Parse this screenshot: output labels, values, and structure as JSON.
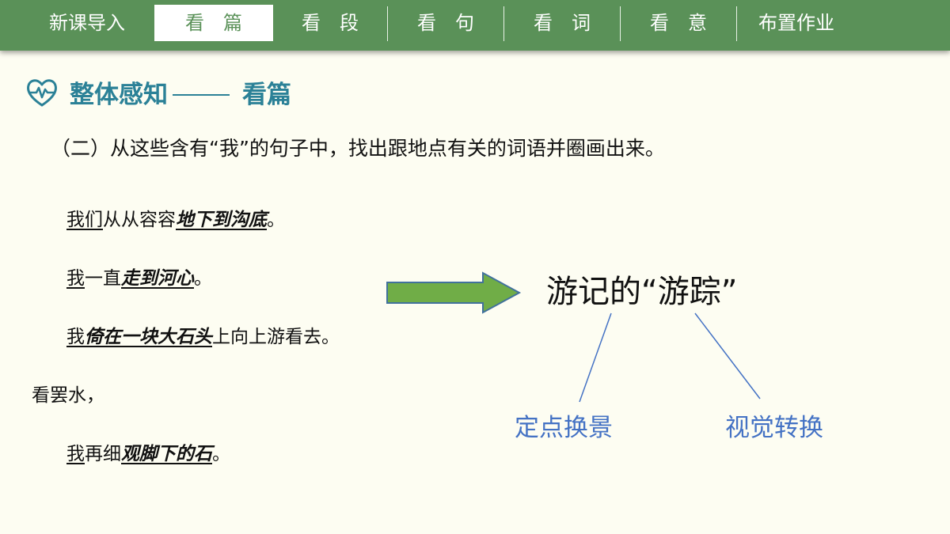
{
  "nav": {
    "tabs": [
      {
        "label": "新课导入",
        "active": false
      },
      {
        "label": "看　篇",
        "active": true
      },
      {
        "label": "看　段",
        "active": false
      },
      {
        "label": "看　句",
        "active": false
      },
      {
        "label": "看　词",
        "active": false
      },
      {
        "label": "看　意",
        "active": false
      },
      {
        "label": "布置作业",
        "active": false
      }
    ]
  },
  "heading": {
    "icon": "heart-pulse-icon",
    "title": "整体感知",
    "subtitle": "看篇"
  },
  "question": "（二）从这些含有“我”的句子中，找出跟地点有关的词语并圈画出来。",
  "sentences": [
    {
      "me": "我们",
      "plain": "从从容容",
      "key": "地下到沟底",
      "end": "。"
    },
    {
      "me": "我",
      "plain": "一直",
      "key": "走到河心",
      "end": "。"
    },
    {
      "me": "我",
      "key": "倚在一块大石头",
      "plain": "上向上游看去。"
    },
    {
      "plain": "看罢水，"
    },
    {
      "me": "我",
      "plain": "再细",
      "key": "观脚下的石",
      "end": "。"
    }
  ],
  "diagram": {
    "main": "游记的“游踪”",
    "left_label": "定点换景",
    "right_label": "视觉转换",
    "colors": {
      "arrow_fill": "#70ad47",
      "arrow_stroke": "#41719c",
      "line": "#4472c4",
      "bar": "#5a9158",
      "heading": "#2b8197"
    }
  }
}
